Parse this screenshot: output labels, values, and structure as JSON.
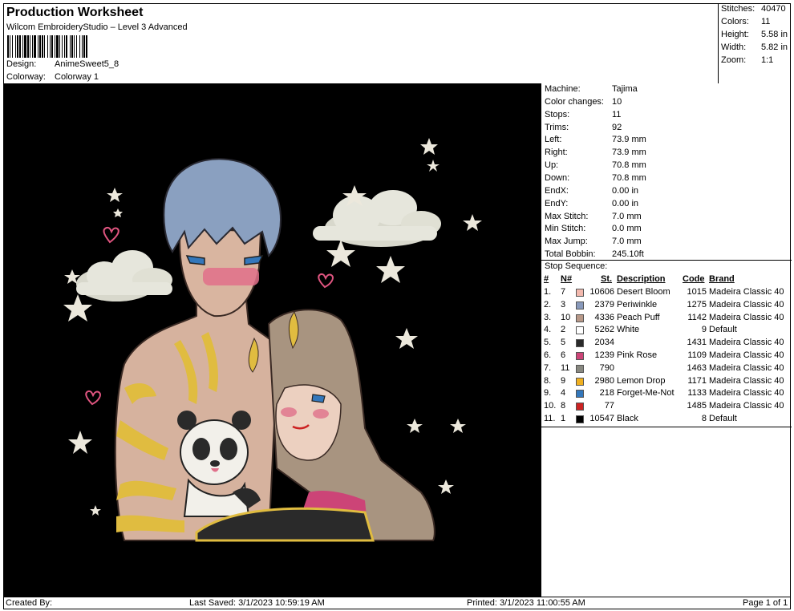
{
  "header": {
    "title": "Production Worksheet",
    "subtitle": "Wilcom EmbroideryStudio – Level 3 Advanced",
    "design_label": "Design:",
    "design_value": "AnimeSweet5_8",
    "colorway_label": "Colorway:",
    "colorway_value": "Colorway 1"
  },
  "stats": [
    {
      "label": "Stitches:",
      "value": "40470"
    },
    {
      "label": "Colors:",
      "value": "11"
    },
    {
      "label": "Height:",
      "value": "5.58 in"
    },
    {
      "label": "Width:",
      "value": "5.82 in"
    },
    {
      "label": "Zoom:",
      "value": "1:1"
    }
  ],
  "machine_info": [
    {
      "label": "Machine:",
      "value": "Tajima"
    },
    {
      "label": "Color changes:",
      "value": "10"
    },
    {
      "label": "Stops:",
      "value": "11"
    },
    {
      "label": "Trims:",
      "value": "92"
    },
    {
      "label": "Left:",
      "value": "73.9 mm"
    },
    {
      "label": "Right:",
      "value": "73.9 mm"
    },
    {
      "label": "Up:",
      "value": "70.8 mm"
    },
    {
      "label": "Down:",
      "value": "70.8 mm"
    },
    {
      "label": "EndX:",
      "value": "0.00 in"
    },
    {
      "label": "EndY:",
      "value": "0.00 in"
    },
    {
      "label": "Max Stitch:",
      "value": "7.0 mm"
    },
    {
      "label": "Min Stitch:",
      "value": "0.0 mm"
    },
    {
      "label": "Max Jump:",
      "value": "7.0 mm"
    },
    {
      "label": "Total Bobbin:",
      "value": "245.10ft"
    }
  ],
  "stop_sequence": {
    "title": "Stop Sequence:",
    "headers": {
      "idx": "#",
      "n": "N#",
      "st": "St.",
      "desc": "Description",
      "code": "Code",
      "brand": "Brand"
    },
    "rows": [
      {
        "idx": "1.",
        "n": "7",
        "color": "#f3b9ae",
        "st": "10606",
        "desc": "Desert Bloom",
        "code": "1015",
        "brand": "Madeira Classic 40"
      },
      {
        "idx": "2.",
        "n": "3",
        "color": "#8899bb",
        "st": "2379",
        "desc": "Periwinkle",
        "code": "1275",
        "brand": "Madeira Classic 40"
      },
      {
        "idx": "3.",
        "n": "10",
        "color": "#b89888",
        "st": "4336",
        "desc": "Peach Puff",
        "code": "1142",
        "brand": "Madeira Classic 40"
      },
      {
        "idx": "4.",
        "n": "2",
        "color": "#ffffff",
        "st": "5262",
        "desc": "White",
        "code": "9",
        "brand": "Default"
      },
      {
        "idx": "5.",
        "n": "5",
        "color": "#2a2a2a",
        "st": "2034",
        "desc": "",
        "code": "1431",
        "brand": "Madeira Classic 40"
      },
      {
        "idx": "6.",
        "n": "6",
        "color": "#cc4477",
        "st": "1239",
        "desc": "Pink Rose",
        "code": "1109",
        "brand": "Madeira Classic 40"
      },
      {
        "idx": "7.",
        "n": "11",
        "color": "#888880",
        "st": "790",
        "desc": "",
        "code": "1463",
        "brand": "Madeira Classic 40"
      },
      {
        "idx": "8.",
        "n": "9",
        "color": "#f0b020",
        "st": "2980",
        "desc": "Lemon Drop",
        "code": "1171",
        "brand": "Madeira Classic 40"
      },
      {
        "idx": "9.",
        "n": "4",
        "color": "#3377bb",
        "st": "218",
        "desc": "Forget-Me-Not",
        "code": "1133",
        "brand": "Madeira Classic 40"
      },
      {
        "idx": "10.",
        "n": "8",
        "color": "#cc2222",
        "st": "77",
        "desc": "",
        "code": "1485",
        "brand": "Madeira Classic 40"
      },
      {
        "idx": "11.",
        "n": "1",
        "color": "#000000",
        "st": "10547",
        "desc": "Black",
        "code": "8",
        "brand": "Default"
      }
    ]
  },
  "footer": {
    "created_by": "Created By:",
    "last_saved": "Last Saved: 3/1/2023 10:59:19 AM",
    "printed": "Printed: 3/1/2023 11:00:55 AM",
    "page": "Page 1 of 1"
  },
  "design_image": {
    "icon": "embroidery-design-preview",
    "palette": {
      "hair_blue": "#8aa0c0",
      "hair_brown": "#a89480",
      "skin": "#d9b5a0",
      "gold": "#e0bc40",
      "cloud": "#e6e6dc",
      "star": "#ece8dc",
      "heart": "#e05580",
      "blush": "#e0708a"
    }
  }
}
